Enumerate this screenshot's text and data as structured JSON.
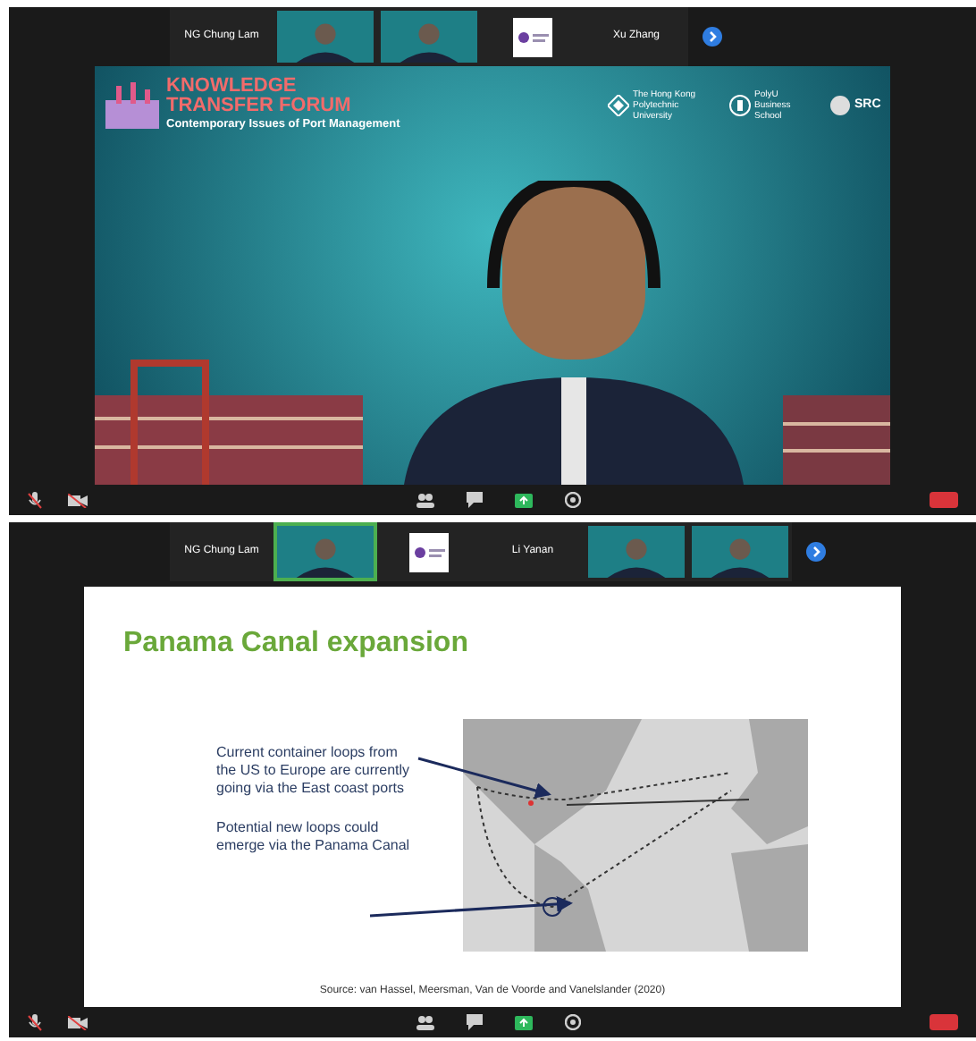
{
  "panels": [
    {
      "tiles": [
        {
          "kind": "name",
          "name": "NG Chung Lam",
          "selected": false
        },
        {
          "kind": "video",
          "selected": false
        },
        {
          "kind": "video",
          "selected": false
        },
        {
          "kind": "logo",
          "selected": false
        },
        {
          "kind": "name",
          "name": "Xu Zhang",
          "selected": false
        }
      ],
      "main": {
        "kind": "banner",
        "title_lines": [
          "KNOWLEDGE",
          "TRANSFER FORUM"
        ],
        "subtitle": "Contemporary Issues of Port Management",
        "partners": [
          "The Hong Kong Polytechnic University",
          "PolyU Business School",
          "SRC"
        ]
      }
    },
    {
      "tiles": [
        {
          "kind": "name",
          "name": "NG Chung Lam",
          "selected": false
        },
        {
          "kind": "video",
          "selected": true
        },
        {
          "kind": "logo",
          "selected": false
        },
        {
          "kind": "name",
          "name": "Li Yanan",
          "selected": false
        },
        {
          "kind": "video",
          "selected": false
        },
        {
          "kind": "video",
          "selected": false
        }
      ],
      "main": {
        "kind": "slide",
        "title": "Panama Canal expansion",
        "notes": [
          "Current container loops from the US to Europe are currently going via the East coast ports",
          "Potential new loops could emerge via the Panama Canal"
        ],
        "source": "Source: van Hassel, Meersman, Van de Voorde and Vanelslander (2020)"
      }
    }
  ]
}
